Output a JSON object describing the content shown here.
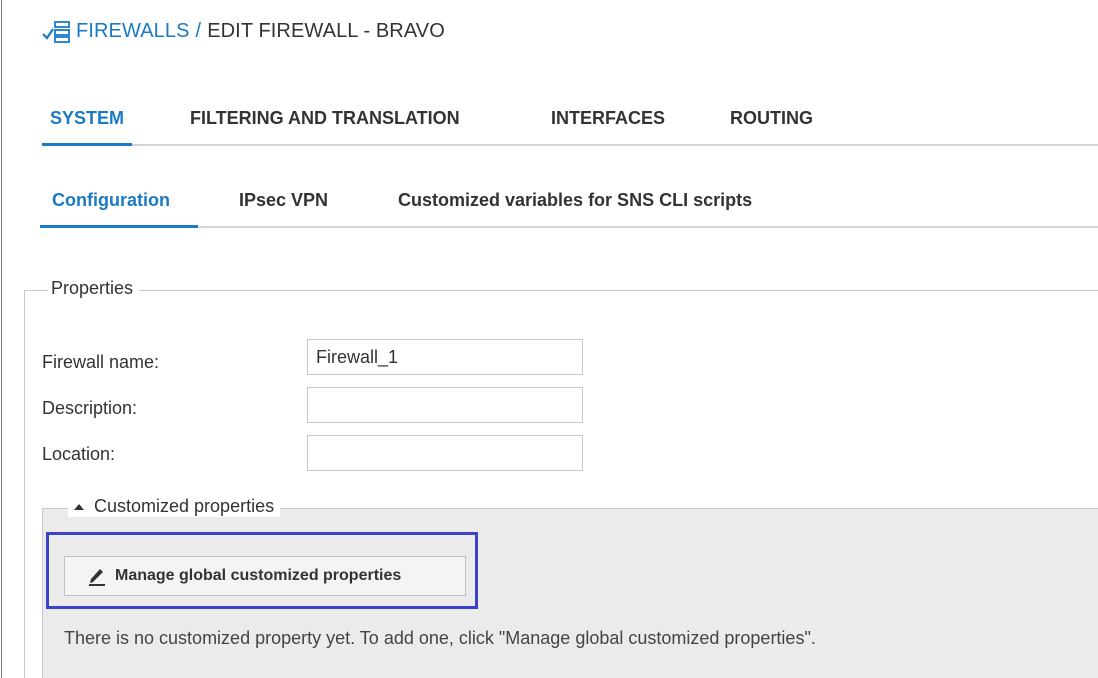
{
  "breadcrumb": {
    "parent": "FIREWALLS",
    "separator": "/",
    "current": "EDIT FIREWALL - BRAVO",
    "icon": "firewall-list-icon"
  },
  "main_tabs": [
    {
      "label": "SYSTEM",
      "active": true
    },
    {
      "label": "FILTERING AND TRANSLATION",
      "active": false
    },
    {
      "label": "INTERFACES",
      "active": false
    },
    {
      "label": "ROUTING",
      "active": false
    }
  ],
  "sub_tabs": [
    {
      "label": "Configuration",
      "active": true
    },
    {
      "label": "IPsec VPN",
      "active": false
    },
    {
      "label": "Customized variables for SNS CLI scripts",
      "active": false
    }
  ],
  "properties": {
    "legend": "Properties",
    "fields": [
      {
        "label": "Firewall name:",
        "value": "Firewall_1"
      },
      {
        "label": "Description:",
        "value": ""
      },
      {
        "label": "Location:",
        "value": ""
      }
    ]
  },
  "customized": {
    "legend": "Customized properties",
    "toggle_icon": "triangle-up-icon",
    "button_label": "Manage global customized properties",
    "button_icon": "pencil-icon",
    "info_text": "There is no customized property yet. To add one, click \"Manage global customized properties\"."
  },
  "colors": {
    "accent": "#1a7ac3",
    "highlight": "#3b43c9",
    "panel_bg": "#ebebeb"
  }
}
